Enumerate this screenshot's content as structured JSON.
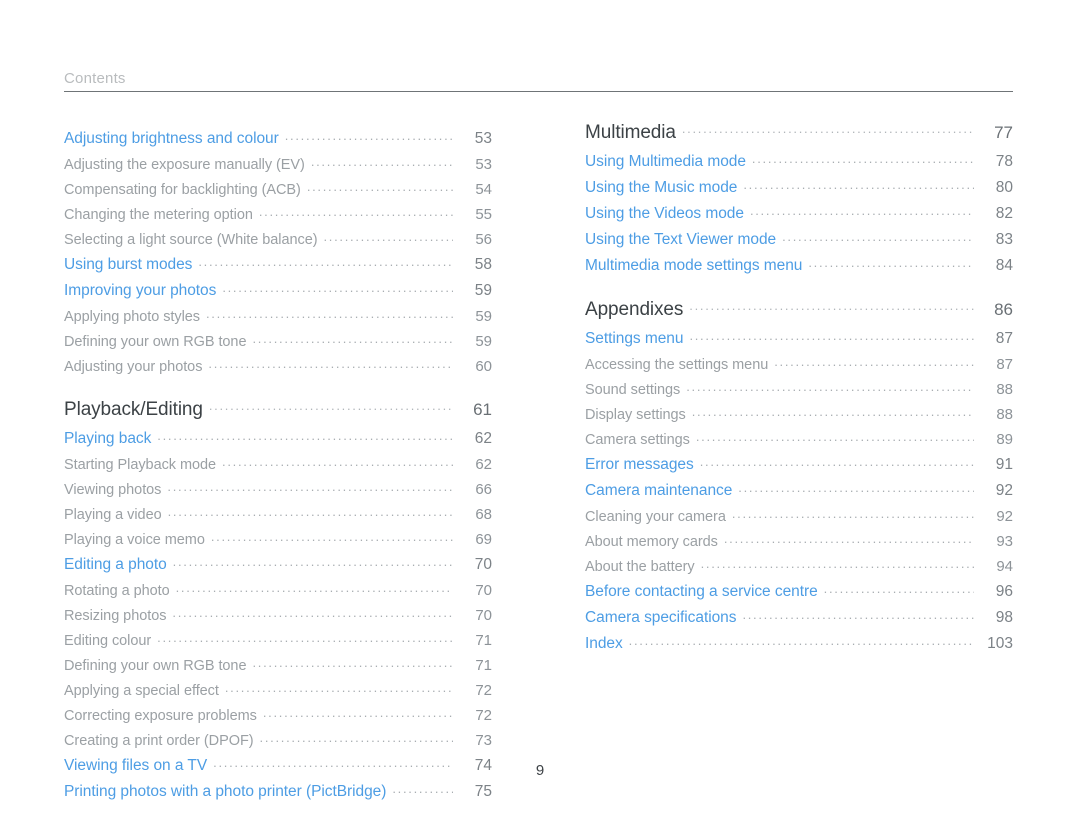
{
  "header": {
    "title": "Contents"
  },
  "footer": {
    "page_number": "9"
  },
  "colors": {
    "link_blue": "#4d9de4",
    "heading_dark": "#3c4246",
    "item_gray": "#9ba0a4",
    "page_gray": "#7c8287",
    "rule": "#6f7477",
    "header_gray": "#b9bcbe"
  },
  "columns": {
    "left": [
      {
        "level": "link",
        "label": "Adjusting brightness and colour",
        "page": "53"
      },
      {
        "level": "item",
        "label": "Adjusting the exposure manually (EV)",
        "page": "53"
      },
      {
        "level": "item",
        "label": "Compensating for backlighting (ACB)",
        "page": "54"
      },
      {
        "level": "item",
        "label": "Changing the metering option",
        "page": "55"
      },
      {
        "level": "item",
        "label": "Selecting a light source (White balance)",
        "page": "56"
      },
      {
        "level": "link",
        "label": "Using burst modes",
        "page": "58"
      },
      {
        "level": "link",
        "label": "Improving your photos",
        "page": "59"
      },
      {
        "level": "item",
        "label": "Applying photo styles",
        "page": "59"
      },
      {
        "level": "item",
        "label": "Defining your own RGB tone",
        "page": "59"
      },
      {
        "level": "item",
        "label": "Adjusting your photos",
        "page": "60"
      },
      {
        "level": "heading",
        "label": "Playback/Editing",
        "page": "61"
      },
      {
        "level": "link",
        "label": "Playing back",
        "page": "62"
      },
      {
        "level": "item",
        "label": "Starting Playback mode",
        "page": "62"
      },
      {
        "level": "item",
        "label": "Viewing photos",
        "page": "66"
      },
      {
        "level": "item",
        "label": "Playing a video",
        "page": "68"
      },
      {
        "level": "item",
        "label": "Playing a voice memo",
        "page": "69"
      },
      {
        "level": "link",
        "label": "Editing a photo",
        "page": "70"
      },
      {
        "level": "item",
        "label": "Rotating a photo",
        "page": "70"
      },
      {
        "level": "item",
        "label": "Resizing photos",
        "page": "70"
      },
      {
        "level": "item",
        "label": "Editing colour",
        "page": "71"
      },
      {
        "level": "item",
        "label": "Defining your own RGB tone",
        "page": "71"
      },
      {
        "level": "item",
        "label": "Applying a special effect",
        "page": "72"
      },
      {
        "level": "item",
        "label": "Correcting exposure problems",
        "page": "72"
      },
      {
        "level": "item",
        "label": "Creating a print order (DPOF)",
        "page": "73"
      },
      {
        "level": "link",
        "label": "Viewing files on a TV",
        "page": "74"
      },
      {
        "level": "link",
        "label": "Printing photos with a photo printer (PictBridge)",
        "page": "75"
      }
    ],
    "right": [
      {
        "level": "heading",
        "label": "Multimedia",
        "page": "77"
      },
      {
        "level": "link",
        "label": "Using Multimedia mode",
        "page": "78"
      },
      {
        "level": "link",
        "label": "Using the Music mode",
        "page": "80"
      },
      {
        "level": "link",
        "label": "Using the Videos mode",
        "page": "82"
      },
      {
        "level": "link",
        "label": "Using the Text Viewer mode",
        "page": "83"
      },
      {
        "level": "link",
        "label": "Multimedia mode settings menu",
        "page": "84"
      },
      {
        "level": "heading",
        "label": "Appendixes",
        "page": "86"
      },
      {
        "level": "link",
        "label": "Settings menu",
        "page": "87"
      },
      {
        "level": "item",
        "label": "Accessing the settings menu",
        "page": "87"
      },
      {
        "level": "item",
        "label": "Sound settings",
        "page": "88"
      },
      {
        "level": "item",
        "label": "Display settings",
        "page": "88"
      },
      {
        "level": "item",
        "label": "Camera settings",
        "page": "89"
      },
      {
        "level": "link",
        "label": "Error messages",
        "page": "91"
      },
      {
        "level": "link",
        "label": "Camera maintenance",
        "page": "92"
      },
      {
        "level": "item",
        "label": "Cleaning your camera",
        "page": "92"
      },
      {
        "level": "item",
        "label": "About memory cards",
        "page": "93"
      },
      {
        "level": "item",
        "label": "About the battery",
        "page": "94"
      },
      {
        "level": "link",
        "label": "Before contacting a service centre",
        "page": "96"
      },
      {
        "level": "link",
        "label": "Camera specifications",
        "page": "98"
      },
      {
        "level": "link",
        "label": "Index",
        "page": "103"
      }
    ]
  }
}
